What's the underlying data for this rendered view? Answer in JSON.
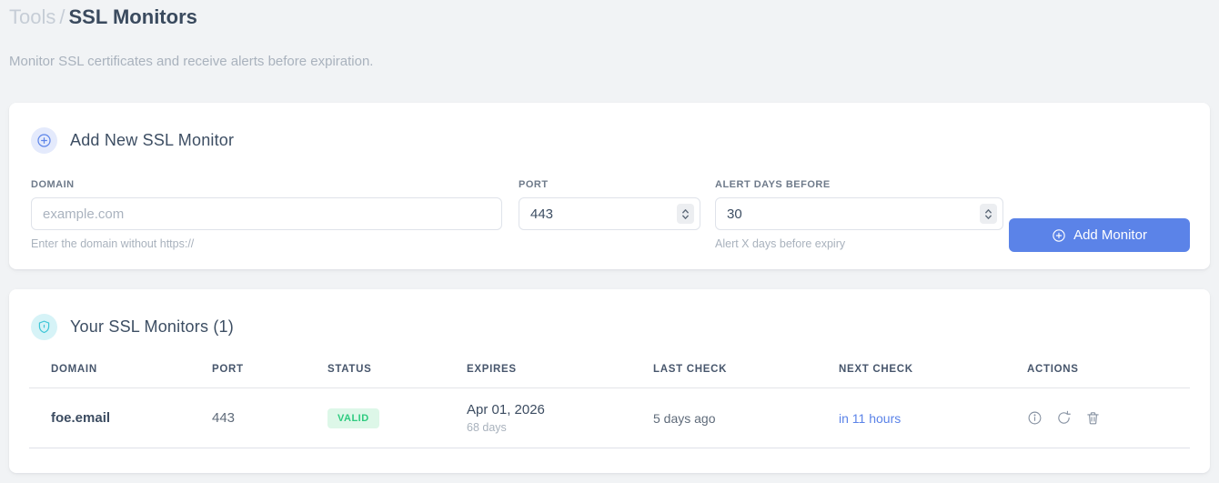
{
  "page": {
    "breadcrumb": {
      "parent": "Tools",
      "separator": "/",
      "current": "SSL Monitors"
    },
    "subtitle": "Monitor SSL certificates and receive alerts before expiration."
  },
  "add_monitor_card": {
    "title": "Add New SSL Monitor",
    "icon": "plus-circle-icon",
    "fields": {
      "domain": {
        "label": "DOMAIN",
        "placeholder": "example.com",
        "helper": "Enter the domain without https://"
      },
      "port": {
        "label": "PORT",
        "value": "443"
      },
      "alert_days": {
        "label": "ALERT DAYS BEFORE",
        "value": "30",
        "helper": "Alert X days before expiry"
      }
    },
    "submit_label": "Add Monitor"
  },
  "monitors_card": {
    "title": "Your SSL Monitors (1)",
    "icon": "shield-icon",
    "table": {
      "columns": [
        "DOMAIN",
        "PORT",
        "STATUS",
        "EXPIRES",
        "LAST CHECK",
        "NEXT CHECK",
        "ACTIONS"
      ],
      "rows": [
        {
          "domain": "foe.email",
          "port": "443",
          "status": "VALID",
          "expires_date": "Apr 01, 2026",
          "expires_days": "68 days",
          "last_check": "5 days ago",
          "next_check": "in 11 hours",
          "actions": [
            "info",
            "refresh",
            "delete"
          ]
        }
      ]
    }
  },
  "colors": {
    "accent_blue": "#5b83e8",
    "shield_cyan": "#3ec6d6",
    "badge_valid_bg": "#ddf7e8",
    "badge_valid_text": "#2ecb7f"
  }
}
